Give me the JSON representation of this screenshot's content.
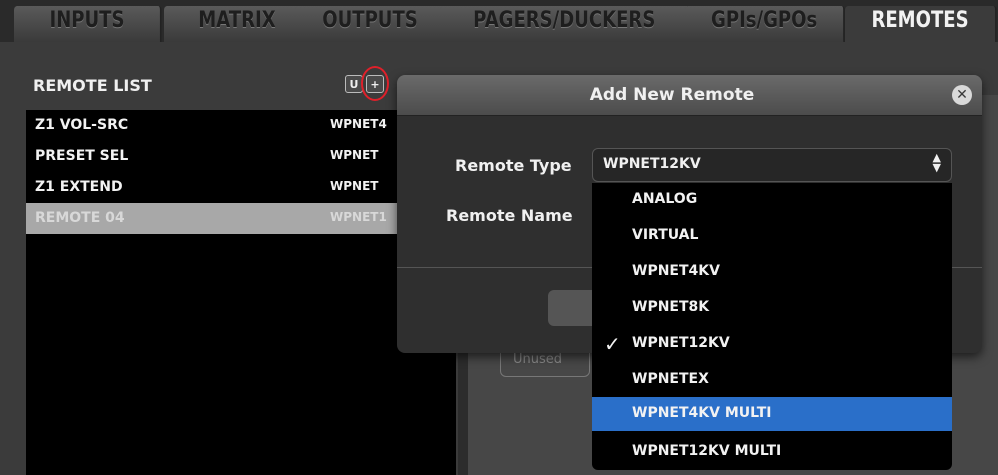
{
  "tabs": [
    {
      "label": "INPUTS",
      "active": false
    },
    {
      "label": "MATRIX",
      "active": false
    },
    {
      "label": "OUTPUTS",
      "active": false
    },
    {
      "label": "PAGERS/DUCKERS",
      "active": false
    },
    {
      "label": "GPIs/GPOs",
      "active": false
    },
    {
      "label": "REMOTES",
      "active": true
    }
  ],
  "remote_list": {
    "title": "REMOTE LIST",
    "btn_u": "U",
    "btn_add": "+",
    "rows": [
      {
        "name": "Z1 VOL-SRC",
        "type": "WPNET4"
      },
      {
        "name": "PRESET SEL",
        "type": "WPNET"
      },
      {
        "name": "Z1 EXTEND",
        "type": "WPNET"
      },
      {
        "name": "REMOTE 04",
        "type": "WPNET1",
        "selected": true
      }
    ]
  },
  "background_field": "Unused",
  "modal": {
    "title": "Add New Remote",
    "close_icon": "close-icon",
    "type_label": "Remote Type",
    "name_label": "Remote Name",
    "selected_type": "WPNET12KV",
    "options": [
      "ANALOG",
      "VIRTUAL",
      "WPNET4KV",
      "WPNET8K",
      "WPNET12KV",
      "WPNETEX",
      "WPNET4KV MULTI",
      "WPNET12KV MULTI"
    ],
    "checked_option": "WPNET12KV",
    "highlighted_option": "WPNET4KV MULTI",
    "check_glyph": "✓"
  },
  "colors": {
    "highlight": "#2a6fc9",
    "annotation": "#e0202a"
  }
}
